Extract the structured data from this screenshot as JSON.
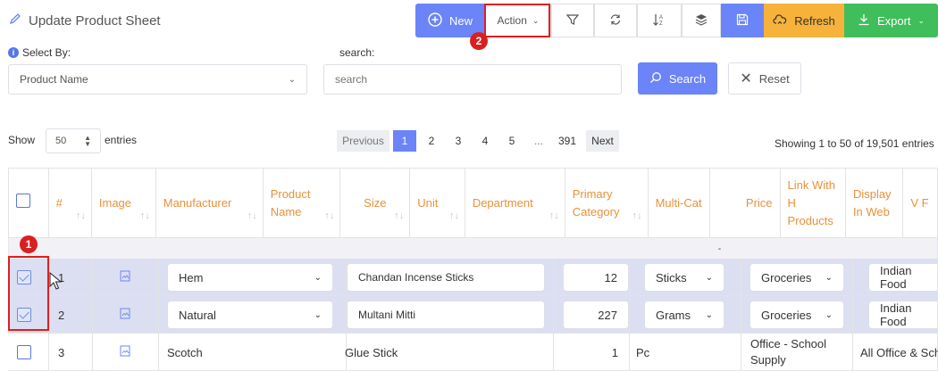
{
  "header": {
    "title": "Update Product Sheet"
  },
  "toolbar": {
    "new_label": "New",
    "action_label": "Action",
    "refresh_label": "Refresh",
    "export_label": "Export"
  },
  "filters": {
    "select_by_label": "Select By:",
    "select_by_value": "Product Name",
    "search_label": "search:",
    "search_placeholder": "search",
    "search_button": "Search",
    "reset_button": "Reset"
  },
  "entries": {
    "show_label": "Show",
    "per_page": "50",
    "entries_label": "entries",
    "summary": "Showing 1 to 50 of 19,501 entries"
  },
  "pagination": {
    "previous": "Previous",
    "pages": [
      "1",
      "2",
      "3",
      "4",
      "5",
      "...",
      "391"
    ],
    "next": "Next"
  },
  "table": {
    "headers": [
      "#",
      "Image",
      "Manufacturer",
      "Product Name",
      "Size",
      "Unit",
      "Department",
      "Primary Category",
      "Multi-Cat",
      "Price",
      "Link With H Products",
      "Display In Web",
      "V F"
    ],
    "separator": "-",
    "rows": [
      {
        "num": "1",
        "manufacturer": "Hem",
        "product": "Chandan Incense Sticks",
        "size": "12",
        "unit": "Sticks",
        "department": "Groceries",
        "display": "Indian Food"
      },
      {
        "num": "2",
        "manufacturer": "Natural",
        "product": "Multani Mitti",
        "size": "227",
        "unit": "Grams",
        "department": "Groceries",
        "display": "Indian Food"
      },
      {
        "num": "3",
        "manufacturer": "Scotch",
        "product": "Glue Stick",
        "size": "1",
        "unit": "Pc",
        "department": "Office - School Supply",
        "display": "All Office & Sch"
      }
    ]
  },
  "annotations": {
    "badge1": "1",
    "badge2": "2"
  },
  "colors": {
    "primary": "#6b84f7",
    "orange": "#f6b23a",
    "green": "#3fbe5b",
    "header_text": "#e8913a",
    "highlight_red": "#e11d1d"
  }
}
